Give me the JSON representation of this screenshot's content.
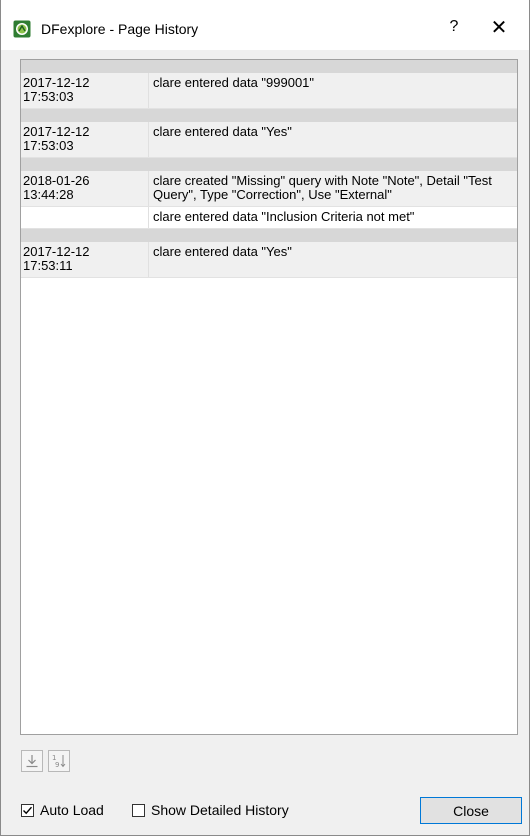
{
  "window": {
    "title": "DFexplore - Page History",
    "help_glyph": "?",
    "close_glyph": "✕"
  },
  "history": {
    "groups": [
      {
        "rows": [
          {
            "date": "2017-12-12\n17:53:03",
            "text": "clare entered data \"999001\""
          }
        ]
      },
      {
        "rows": [
          {
            "date": "2017-12-12\n17:53:03",
            "text": "clare entered data \"Yes\""
          }
        ]
      },
      {
        "rows": [
          {
            "date": "2018-01-26\n13:44:28",
            "text": "clare created \"Missing\" query with Note \"Note\", Detail \"Test Query\", Type \"Correction\", Use \"External\""
          },
          {
            "date": "",
            "text": "clare entered data \"Inclusion Criteria not met\""
          }
        ]
      },
      {
        "rows": [
          {
            "date": "2017-12-12\n17:53:11",
            "text": "clare entered data \"Yes\""
          }
        ]
      }
    ]
  },
  "toolbar": {
    "download_icon": "download-icon",
    "sort_icon": "sort-numeric-icon",
    "sort_glyph_top": "1",
    "sort_glyph_bottom": "9"
  },
  "footer": {
    "auto_load_label": "Auto Load",
    "auto_load_checked": true,
    "show_detailed_label": "Show Detailed History",
    "show_detailed_checked": false,
    "close_label": "Close"
  },
  "colors": {
    "separator": "#d7d7d7",
    "shaded_row": "#f0f0f0",
    "accent_border": "#0078d7",
    "app_icon_green": "#3a9a3a"
  }
}
